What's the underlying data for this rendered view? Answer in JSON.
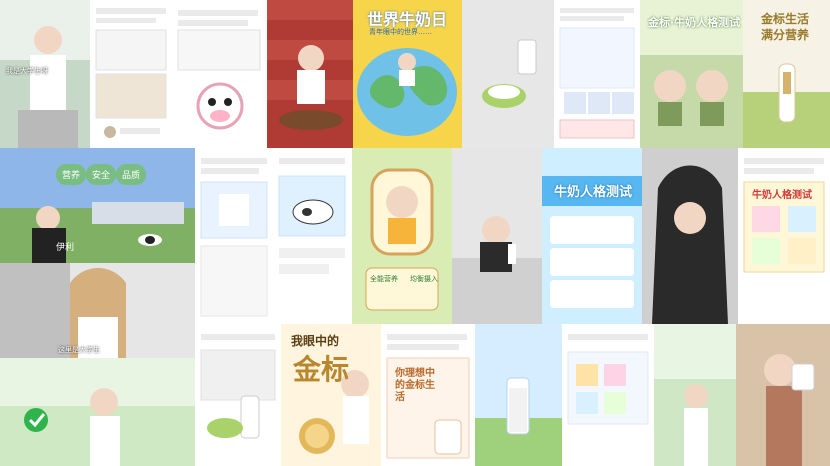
{
  "title_world_milk_day": "世界牛奶日",
  "subtitle_world_milk_day": "青年眼中的世界……",
  "title_milk_personality_1": "金标·牛奶人格测试",
  "title_gold_life": "金标生活",
  "title_gold_life_2": "满分营养",
  "title_milk_personality_2": "牛奶人格测试",
  "title_golden_in_eyes": "我眼中的",
  "title_golden_big": "金标",
  "title_ideal_gold_life": "你理想中的金标生活",
  "title_milk_personality_3": "牛奶人格测试",
  "badge_left_1": "营养",
  "badge_left_2": "安全",
  "badge_left_3": "品质",
  "bottom_label_yili": "伊利",
  "video_caption_1": "我是大学生呀",
  "video_caption_2": "这里是大学生",
  "tag_nutrition": "全能营养",
  "tag_balance": "均衡摄入"
}
